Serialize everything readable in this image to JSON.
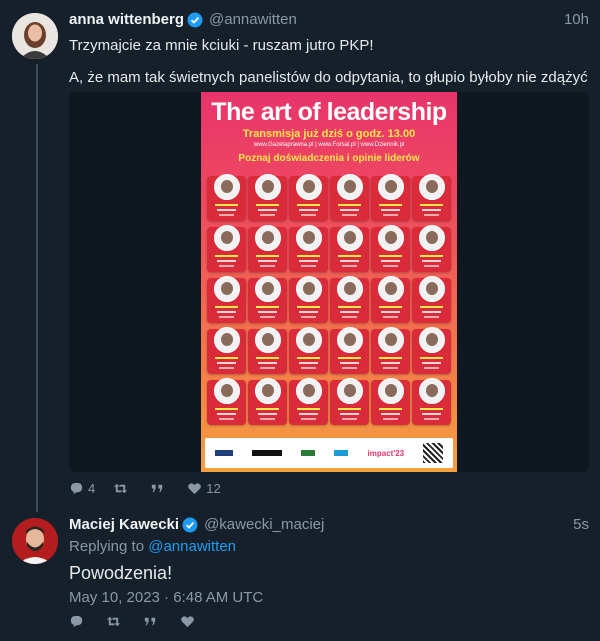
{
  "tweet": {
    "author_name": "anna wittenberg",
    "author_handle": "@annawitten",
    "time": "10h",
    "text_line1": "Trzymajcie za mnie kciuki - ruszam jutro PKP!",
    "text_line2": "A, że mam tak świetnych panelistów do odpytania, to głupio byłoby nie zdążyć",
    "poster": {
      "title": "The art of leadership",
      "subtitle": "Transmisja już dziś o godz. 13.00",
      "links": "www.Gazetaprawna.pl | www.Forsal.pl | www.Dziennik.pl",
      "call": "Poznaj doświadczenia i opinie liderów",
      "brand": "impact'23"
    },
    "stats": {
      "replies": "4",
      "retweets": "",
      "quotes": "",
      "likes": "12"
    }
  },
  "reply": {
    "author_name": "Maciej Kawecki",
    "author_handle": "@kawecki_maciej",
    "time": "5s",
    "replying_prefix": "Replying to",
    "replying_handle": "@annawitten",
    "text": "Powodzenia!",
    "timestamp": "May 10, 2023 · 6:48 AM UTC"
  },
  "colors": {
    "background": "#15202b",
    "accent": "#1d9bf0",
    "muted": "#8b98a5"
  },
  "icons": [
    "verified-badge-icon",
    "reply-icon",
    "retweet-icon",
    "quote-icon",
    "like-icon"
  ]
}
